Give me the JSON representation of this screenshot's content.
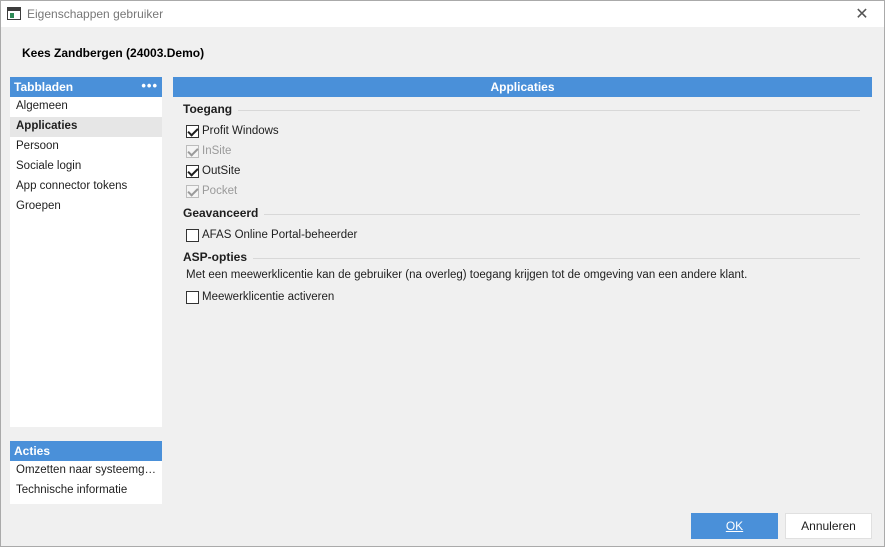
{
  "window": {
    "title": "Eigenschappen gebruiker",
    "close_glyph": "✕"
  },
  "user_header": "Kees Zandbergen (24003.Demo)",
  "tabs": {
    "title": "Tabbladen",
    "menu_glyph": "•••",
    "items": [
      {
        "label": "Algemeen",
        "active": false
      },
      {
        "label": "Applicaties",
        "active": true
      },
      {
        "label": "Persoon",
        "active": false
      },
      {
        "label": "Sociale login",
        "active": false
      },
      {
        "label": "App connector tokens",
        "active": false
      },
      {
        "label": "Groepen",
        "active": false
      }
    ]
  },
  "actions": {
    "title": "Acties",
    "items": [
      {
        "label": "Omzetten naar systeemge..."
      },
      {
        "label": "Technische informatie"
      }
    ]
  },
  "main": {
    "title": "Applicaties",
    "sections": {
      "toegang": {
        "title": "Toegang",
        "items": [
          {
            "label": "Profit Windows",
            "checked": true,
            "disabled": false
          },
          {
            "label": "InSite",
            "checked": true,
            "disabled": true
          },
          {
            "label": "OutSite",
            "checked": true,
            "disabled": false
          },
          {
            "label": "Pocket",
            "checked": true,
            "disabled": true
          }
        ]
      },
      "geavanceerd": {
        "title": "Geavanceerd",
        "items": [
          {
            "label": "AFAS Online Portal-beheerder",
            "checked": false,
            "disabled": false
          }
        ]
      },
      "asp": {
        "title": "ASP-opties",
        "description": "Met een meewerklicentie kan de gebruiker (na overleg) toegang krijgen tot de omgeving van een andere klant.",
        "items": [
          {
            "label": "Meewerklicentie activeren",
            "checked": false,
            "disabled": false
          }
        ]
      }
    }
  },
  "buttons": {
    "ok": "OK",
    "cancel": "Annuleren"
  },
  "colors": {
    "accent": "#4a90d9",
    "active_item": "#e6e6e6"
  }
}
